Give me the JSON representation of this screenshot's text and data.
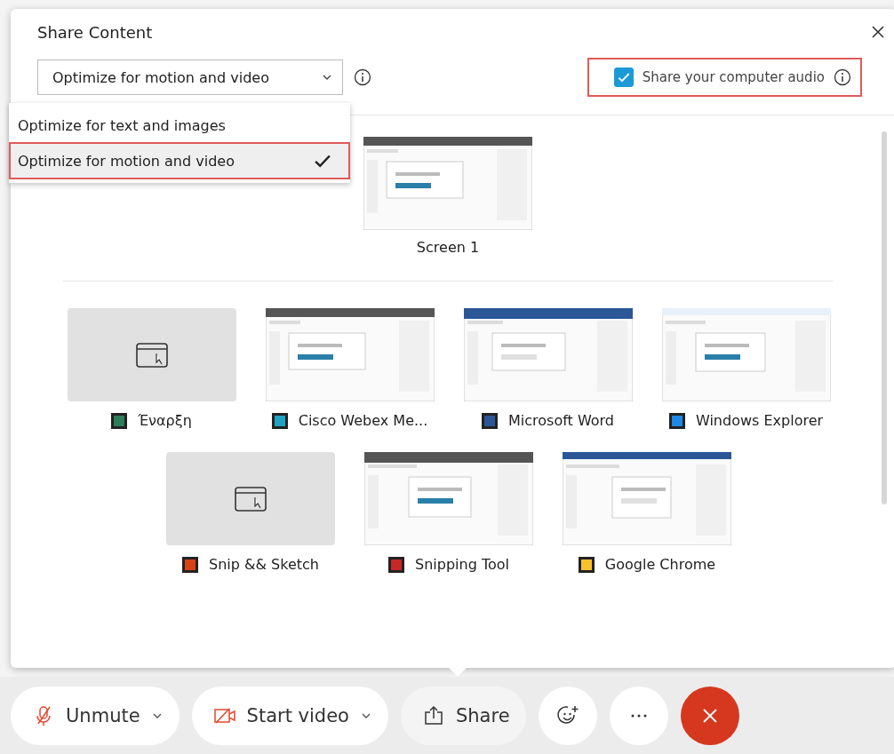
{
  "dialog": {
    "title": "Share Content",
    "optimize": {
      "value": "Optimize for motion and video",
      "expanded": true,
      "options": [
        {
          "label": "Optimize for text and images",
          "selected": false,
          "highlighted": false
        },
        {
          "label": "Optimize for motion and video",
          "selected": true,
          "highlighted": true
        }
      ]
    },
    "audio": {
      "label": "Share your computer audio",
      "checked": true,
      "highlighted": true
    },
    "screens": [
      {
        "label": "Screen 1"
      }
    ],
    "sources": [
      {
        "label": "Έναρξη",
        "kind": "blank",
        "color": "#2e7d5b"
      },
      {
        "label": "Cisco Webex Me...",
        "kind": "window",
        "color": "#1fa3c4"
      },
      {
        "label": "Microsoft Word",
        "kind": "window",
        "color": "#2b5797"
      },
      {
        "label": "Windows Explorer",
        "kind": "window",
        "color": "#1e88e5"
      },
      {
        "label": "Snip && Sketch",
        "kind": "blank",
        "color": "#d84315"
      },
      {
        "label": "Snipping Tool",
        "kind": "window",
        "color": "#c62828"
      },
      {
        "label": "Google Chrome",
        "kind": "window",
        "color": "#fbc02d"
      }
    ]
  },
  "toolbar": [
    {
      "kind": "mute",
      "label": "Unmute"
    },
    {
      "kind": "video",
      "label": "Start video"
    },
    {
      "kind": "share",
      "label": "Share"
    },
    {
      "kind": "reactions"
    },
    {
      "kind": "more"
    },
    {
      "kind": "end"
    }
  ]
}
